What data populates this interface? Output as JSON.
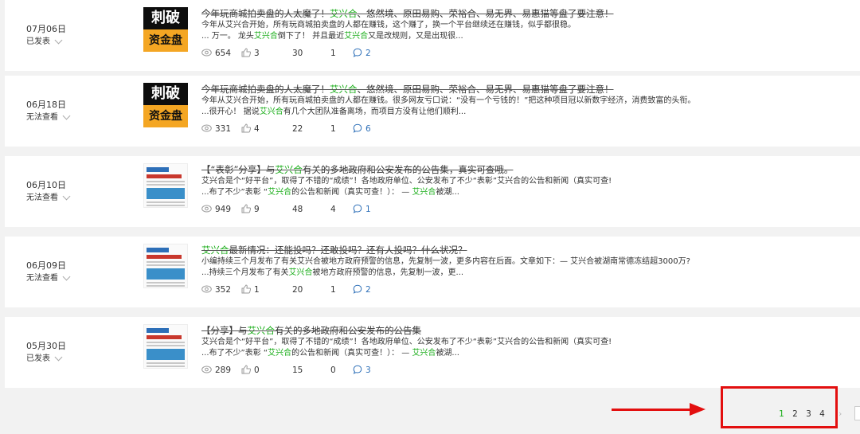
{
  "articles": [
    {
      "date": "07月06日",
      "status": "已发表",
      "thumb": "cipo",
      "thumb_top": "刺破",
      "thumb_bottom": "资金盘",
      "title_a": "今年玩商城拍卖盘的人太魔了！",
      "title_green": "艾兴合",
      "title_b": "、悠然境、原田易购、荣裕合、易无界、易惠猫等盘了要注意！",
      "line1": "今年从艾兴合开始，所有玩商城拍卖盘的人都在赚钱，这个赚了，换一个平台继续还在赚钱，似乎都很稳。",
      "line2_a": "... 万一。 龙头",
      "line2_g1": "艾兴合",
      "line2_b": "倒下了！ 并且最近",
      "line2_g2": "艾兴合",
      "line2_c": "又是改规则，又是出现很...",
      "views": "654",
      "likes": "3",
      "reads": "30",
      "shares": "1",
      "comments": "2"
    },
    {
      "date": "06月18日",
      "status": "无法查看",
      "thumb": "cipo",
      "thumb_top": "刺破",
      "thumb_bottom": "资金盘",
      "title_a": "今年玩商城拍卖盘的人太魔了！",
      "title_green": "艾兴合",
      "title_b": "、悠然境、原田易购、荣裕合、易无界、易惠猫等盘了要注意！",
      "line1": "今年从艾兴合开始，所有玩商城拍卖盘的人都在赚钱。很多网友亏口说：“没有一个亏钱的！”把这种项目冠以新数字经济，消费致富的头衔。",
      "line2_a": "...很开心！ 据说",
      "line2_g1": "艾兴合",
      "line2_b": "有几个大团队准备离场，而项目方没有让他们顺利...",
      "line2_g2": "",
      "line2_c": "",
      "views": "331",
      "likes": "4",
      "reads": "22",
      "shares": "1",
      "comments": "6"
    },
    {
      "date": "06月10日",
      "status": "无法查看",
      "thumb": "doc",
      "title_a": "【“表彰”分享】与",
      "title_green": "艾兴合",
      "title_b": "有关的多地政府和公安发布的公告集，真实可查哦。",
      "line1": "艾兴合是个“好平台”，取得了不错的“成绩”！各地政府单位、公安发布了不少“表彰”艾兴合的公告和新闻（真实可查!",
      "line2_a": "...布了不少”表彰 “",
      "line2_g1": "艾兴合",
      "line2_b": "的公告和新闻（真实可查！）： — ",
      "line2_g2": "艾兴合",
      "line2_c": "被潮...",
      "views": "949",
      "likes": "9",
      "reads": "48",
      "shares": "4",
      "comments": "1"
    },
    {
      "date": "06月09日",
      "status": "无法查看",
      "thumb": "doc",
      "title_a": "",
      "title_green": "艾兴合",
      "title_b": "最新情况：还能投吗？还敢投吗？还有人投吗？什么状况？",
      "line1": "小编持续三个月发布了有关艾兴合被地方政府预警的信息，先复制一波，更多内容在后面。文章如下：— 艾兴合被湖南常德冻结超3000万?",
      "line2_a": "...持续三个月发布了有关",
      "line2_g1": "艾兴合",
      "line2_b": "被地方政府预警的信息，先复制一波，更...",
      "line2_g2": "",
      "line2_c": "",
      "views": "352",
      "likes": "1",
      "reads": "20",
      "shares": "1",
      "comments": "2"
    },
    {
      "date": "05月30日",
      "status": "已发表",
      "thumb": "doc",
      "title_a": "【分享】与",
      "title_green": "艾兴合",
      "title_b": "有关的多地政府和公安发布的公告集",
      "line1": "艾兴合是个“好平台”，取得了不错的“成绩”！各地政府单位、公安发布了不少“表彰”艾兴合的公告和新闻（真实可查!",
      "line2_a": "...布了不少”表彰 “",
      "line2_g1": "艾兴合",
      "line2_b": "的公告和新闻（真实可查！）： — ",
      "line2_g2": "艾兴合",
      "line2_c": "被湖...",
      "views": "289",
      "likes": "0",
      "reads": "15",
      "shares": "0",
      "comments": "3"
    }
  ],
  "pagination": {
    "pages": [
      "1",
      "2",
      "3",
      "4"
    ],
    "active": "1"
  },
  "colors": {
    "accent_green": "#1aad19",
    "annotation_red": "#e30f0f"
  }
}
